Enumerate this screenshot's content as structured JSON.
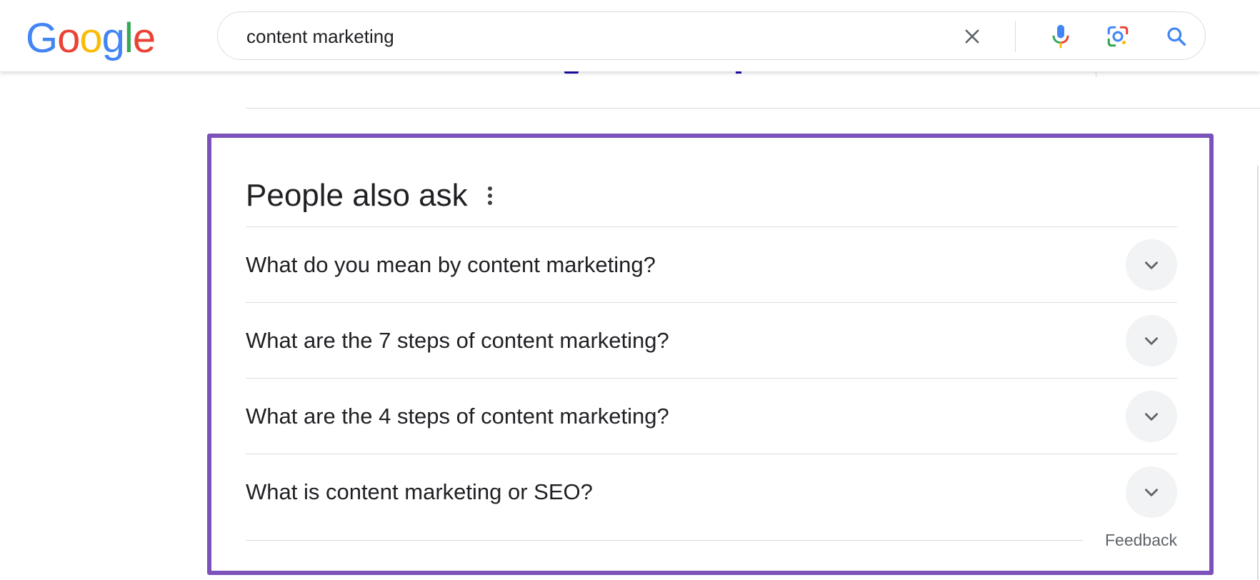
{
  "header": {
    "logo": {
      "letters": [
        "G",
        "o",
        "o",
        "g",
        "l",
        "e"
      ],
      "colors": [
        "#4285F4",
        "#EA4335",
        "#FBBC05",
        "#4285F4",
        "#34A853",
        "#EA4335"
      ]
    },
    "search": {
      "value": "content marketing",
      "placeholder": ""
    },
    "icons": [
      "clear-icon",
      "microphone-icon",
      "lens-camera-icon",
      "search-icon"
    ]
  },
  "people_also_ask": {
    "title": "People also ask",
    "questions": [
      "What do you mean by content marketing?",
      "What are the 7 steps of content marketing?",
      "What are the 4 steps of content marketing?",
      "What is content marketing or SEO?"
    ],
    "feedback_label": "Feedback"
  },
  "colors": {
    "highlight_border": "#7b52b9",
    "text": "#202124",
    "divider": "#dadce0",
    "chevron_bg": "#f1f3f4"
  }
}
